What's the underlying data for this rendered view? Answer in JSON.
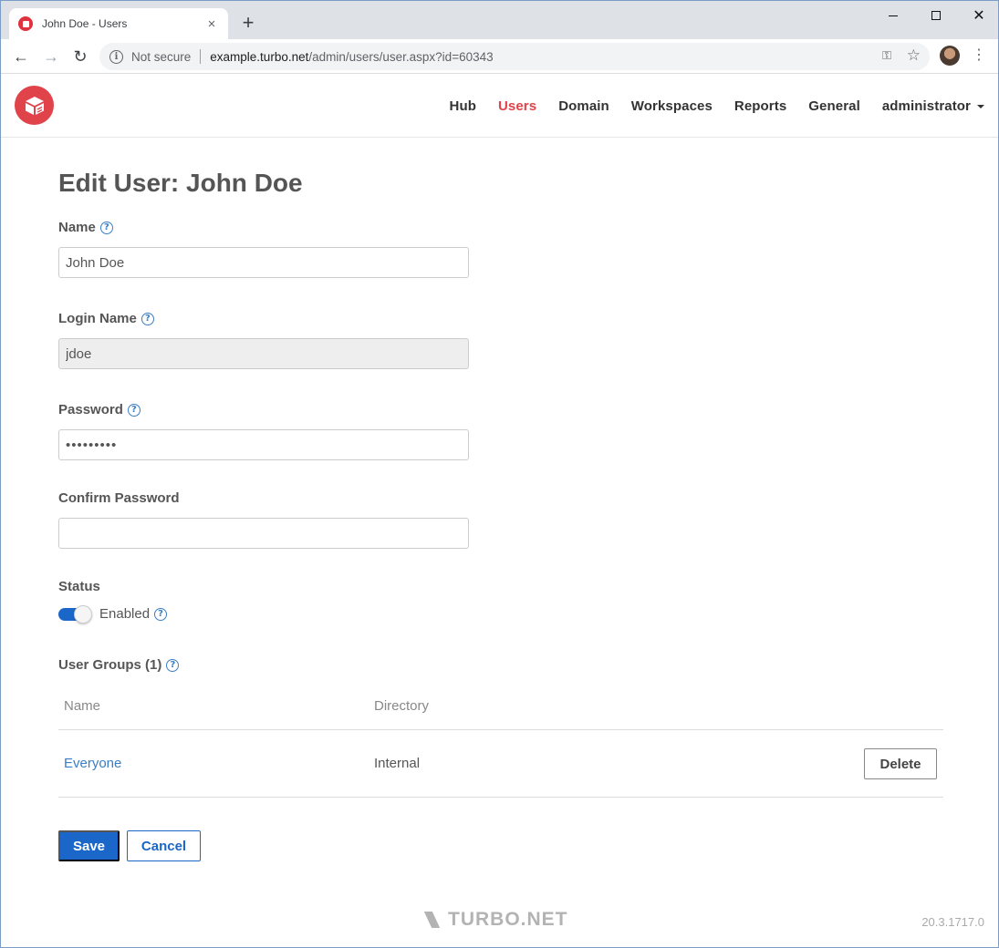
{
  "browser": {
    "tab_title": "John Doe - Users",
    "tab_close": "×",
    "new_tab": "+",
    "not_secure": "Not secure",
    "url_host": "example.turbo.net",
    "url_path": "/admin/users/user.aspx?id=60343",
    "window_close": "✕",
    "menu": "⋮",
    "back": "←",
    "forward": "→",
    "reload": "↻",
    "star": "☆",
    "key": "⚿"
  },
  "nav": {
    "items": [
      {
        "label": "Hub"
      },
      {
        "label": "Users",
        "active": true
      },
      {
        "label": "Domain"
      },
      {
        "label": "Workspaces"
      },
      {
        "label": "Reports"
      },
      {
        "label": "General"
      }
    ],
    "user_menu": "administrator"
  },
  "form": {
    "title": "Edit User: John Doe",
    "name_label": "Name",
    "name_value": "John Doe",
    "login_label": "Login Name",
    "login_value": "jdoe",
    "password_label": "Password",
    "password_value": "•••••••••",
    "confirm_label": "Confirm Password",
    "confirm_value": "",
    "status_label": "Status",
    "status_value": "Enabled",
    "status_enabled": true,
    "groups_label": "User Groups (1)",
    "help_glyph": "?"
  },
  "groups_table": {
    "headers": [
      "Name",
      "Directory"
    ],
    "rows": [
      {
        "name": "Everyone",
        "directory": "Internal",
        "action": "Delete"
      }
    ]
  },
  "actions": {
    "save": "Save",
    "cancel": "Cancel"
  },
  "footer": {
    "brand": "TURBO.NET",
    "version": "20.3.1717.0"
  },
  "colors": {
    "brand_red": "#e0434a",
    "primary_blue": "#1a66c9",
    "link_blue": "#3a7ec5"
  }
}
